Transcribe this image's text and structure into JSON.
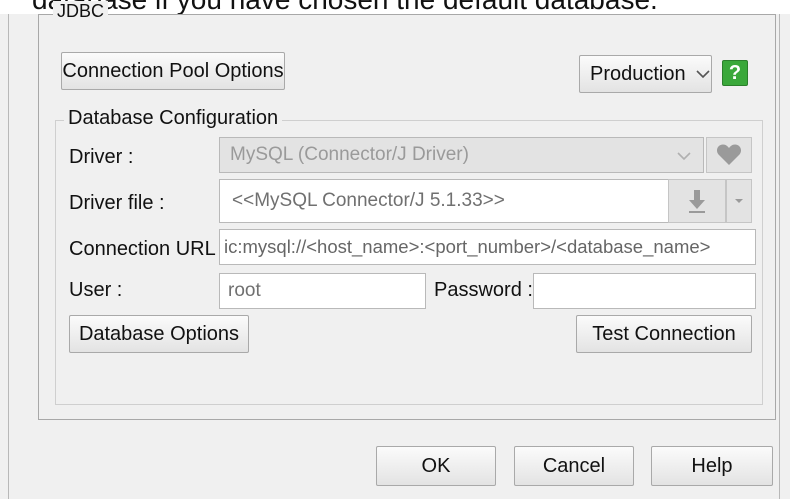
{
  "cut_text": "database if you have chosen the default database.",
  "jdbc_title": "JDBC",
  "connection_pool_label": "Connection Pool Options",
  "profile": {
    "selected": "Production"
  },
  "help_badge": "?",
  "db_config": {
    "title": "Database Configuration",
    "driver_label": "Driver :",
    "driver_value": "MySQL (Connector/J Driver)",
    "driver_file_label": "Driver file :",
    "driver_file_value": "<<MySQL Connector/J 5.1.33>>",
    "url_label": "Connection URL :",
    "url_value": "ic:mysql://<host_name>:<port_number>/<database_name>",
    "user_label": "User :",
    "user_value": "root",
    "password_label": "Password :",
    "password_value": "",
    "db_options_label": "Database Options",
    "test_connection_label": "Test Connection"
  },
  "footer": {
    "ok": "OK",
    "cancel": "Cancel",
    "help": "Help"
  },
  "colors": {
    "help_green": "#3aa83a",
    "dialog_bg": "#f0f0f0",
    "disabled_field": "#e3e3e3"
  }
}
